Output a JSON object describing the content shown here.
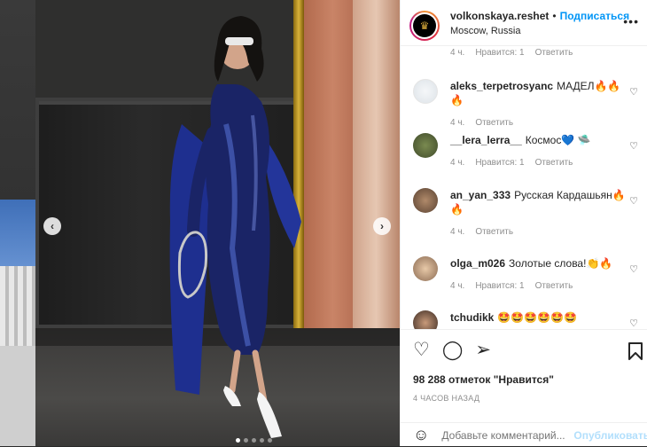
{
  "post": {
    "username": "volkonskaya.reshet",
    "follow_label": "Подписаться",
    "location": "Moscow, Russia",
    "more_icon": "more-horizontal-icon"
  },
  "comments": [
    {
      "username": "",
      "text": "",
      "time": "4 ч.",
      "likes": "Нравится: 1",
      "reply": "Ответить"
    },
    {
      "username": "aleks_terpetrosyanc",
      "text": "МАДЕЛ🔥🔥🔥",
      "time": "4 ч.",
      "likes": "",
      "reply": "Ответить"
    },
    {
      "username": "__lera_lerra__",
      "text": "Космос💙 🛸",
      "time": "4 ч.",
      "likes": "Нравится: 1",
      "reply": "Ответить"
    },
    {
      "username": "an_yan_333",
      "text": "Русская Кардашьян🔥 🔥",
      "time": "4 ч.",
      "likes": "",
      "reply": "Ответить"
    },
    {
      "username": "olga_m026",
      "text": "Золотые слова!👏🔥",
      "time": "4 ч.",
      "likes": "Нравится: 1",
      "reply": "Ответить"
    },
    {
      "username": "tchudikk",
      "text": "🤩🤩🤩🤩🤩🤩",
      "time": "",
      "likes": "",
      "reply": ""
    }
  ],
  "actions": {
    "likes_text": "98 288 отметок \"Нравится\"",
    "time_ago": "4 ЧАСОВ НАЗАД",
    "comment_placeholder": "Добавьте комментарий...",
    "publish_label": "Опубликовать"
  },
  "carousel": {
    "slide_count": 5,
    "active_index": 0
  },
  "colors": {
    "accent": "#0095f6",
    "text": "#262626",
    "muted": "#8e8e8e"
  }
}
